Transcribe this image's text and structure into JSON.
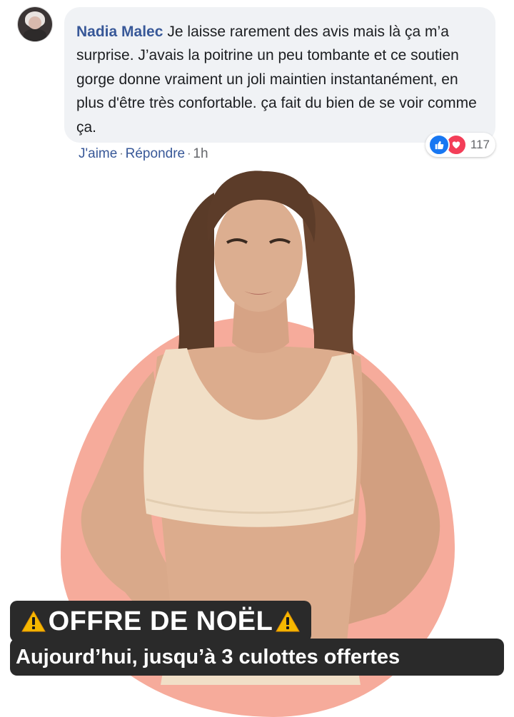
{
  "comment": {
    "author": "Nadia Malec",
    "text": "Je laisse rarement des avis mais là ça m’a surprise. J’avais la poitrine un peu tombante et ce soutien gorge donne vraiment un joli maintien instantanément, en plus d'être très confortable. ça fait du bien de se voir comme ça.",
    "reactions": {
      "icons": [
        "like-icon",
        "love-icon"
      ],
      "count": "117"
    },
    "actions": {
      "like": "J'aime",
      "reply": "Répondre",
      "separator": "·",
      "time": "1h"
    }
  },
  "promo": {
    "title": "OFFRE DE NOËL",
    "subtitle": "Aujourd’hui, jusqu’à 3 culottes offertes",
    "icon": "warning-icon"
  },
  "colors": {
    "author_blue": "#385898",
    "bubble_bg": "#f0f2f5",
    "blob_salmon": "#f6ab9b",
    "bra_nude": "#f1dfc7",
    "banner_bg": "#2a2a2a",
    "like_blue": "#1877f2",
    "love_red": "#f33e58",
    "warning_yellow": "#f5b800"
  }
}
